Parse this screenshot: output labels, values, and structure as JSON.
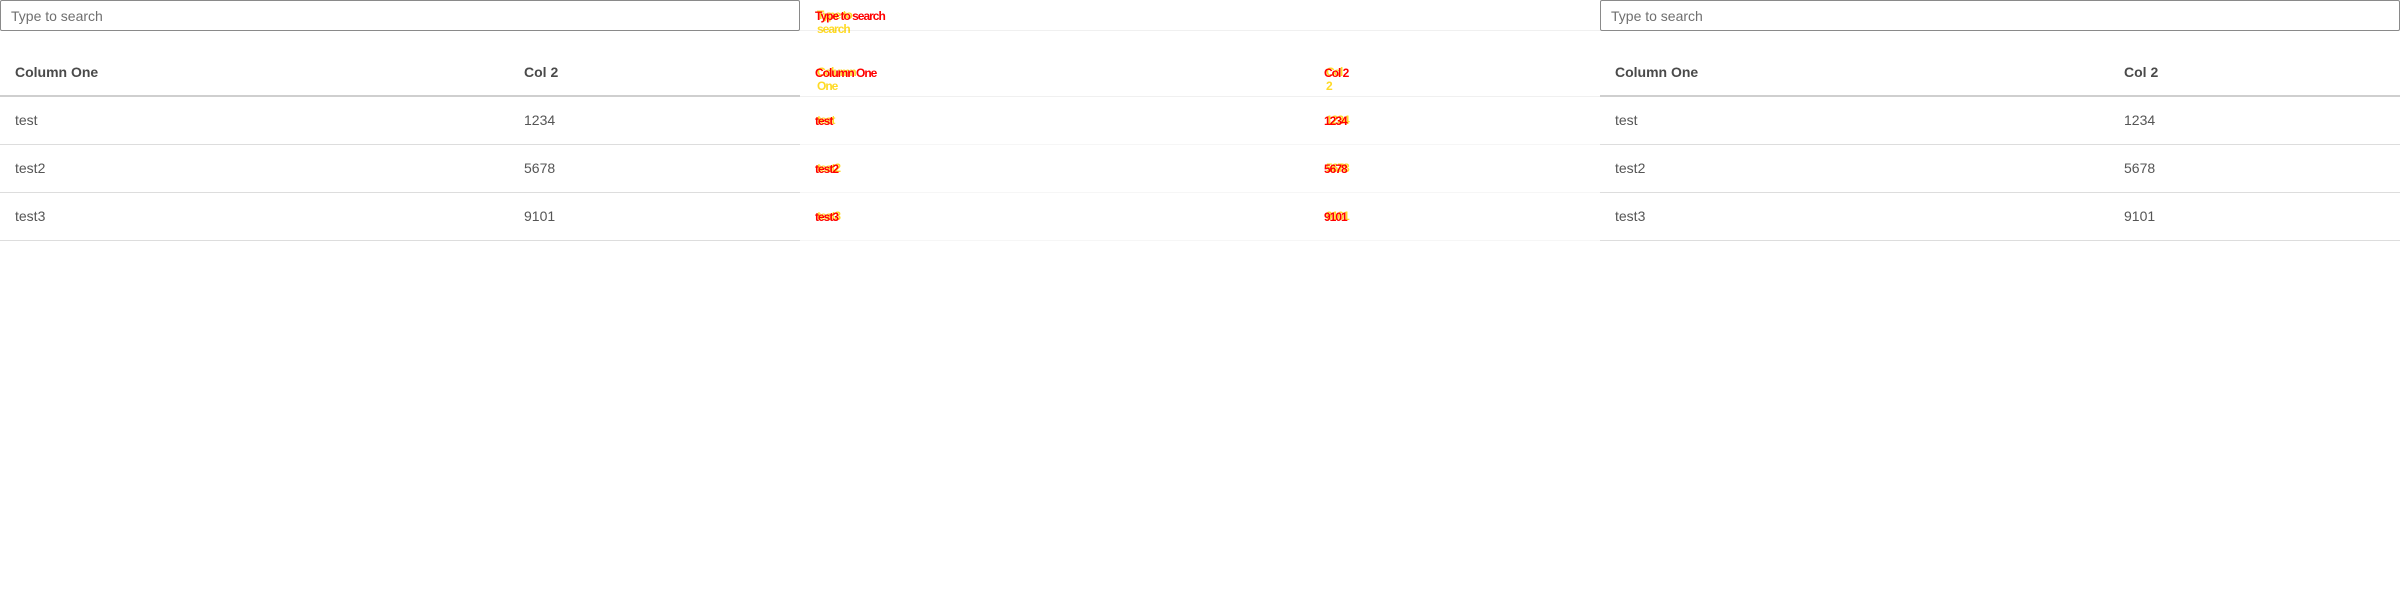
{
  "panels": {
    "left": {
      "search_placeholder": "Type to search",
      "columns": [
        "Column One",
        "Col 2"
      ],
      "rows": [
        [
          "test",
          "1234"
        ],
        [
          "test2",
          "5678"
        ],
        [
          "test3",
          "9101"
        ]
      ]
    },
    "middle": {
      "search_placeholder": "Type to search",
      "columns": [
        "Column One",
        "Col 2"
      ],
      "rows": [
        [
          "test",
          "1234"
        ],
        [
          "test2",
          "5678"
        ],
        [
          "test3",
          "9101"
        ]
      ]
    },
    "right": {
      "search_placeholder": "Type to search",
      "columns": [
        "Column One",
        "Col 2"
      ],
      "rows": [
        [
          "test",
          "1234"
        ],
        [
          "test2",
          "5678"
        ],
        [
          "test3",
          "9101"
        ]
      ]
    }
  },
  "colors": {
    "glitch_primary": "#ff0000",
    "glitch_secondary": "#ffd400",
    "text": "#555555",
    "border": "#8a8a8a"
  }
}
